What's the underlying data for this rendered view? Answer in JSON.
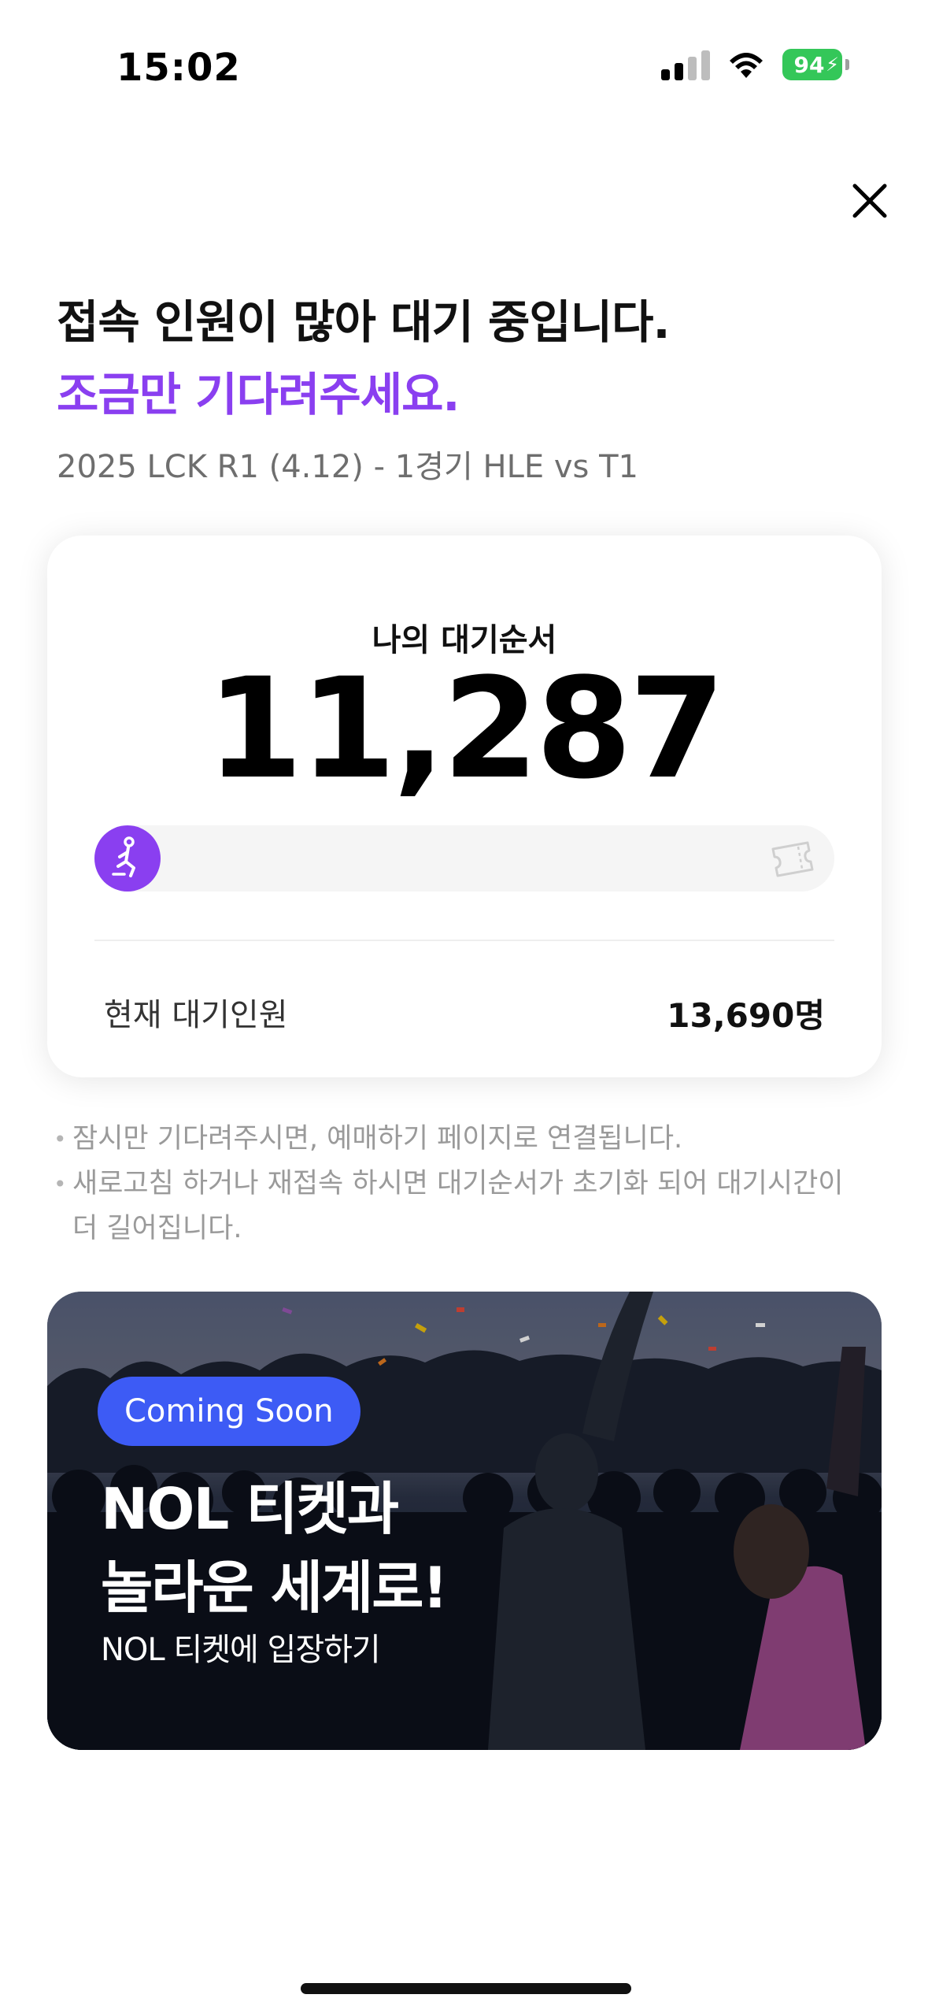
{
  "status_bar": {
    "time": "15:02",
    "battery_level": "94",
    "battery_color": "#34c759",
    "signal_icon": "cellular-signal-icon",
    "wifi_icon": "wifi-icon"
  },
  "header": {
    "close_icon": "close-icon"
  },
  "waiting": {
    "title_line1": "접속 인원이 많아 대기 중입니다.",
    "title_line2": "조금만 기다려주세요.",
    "event_name": "2025 LCK R1 (4.12) - 1경기 HLE vs T1",
    "accent_color": "#8a3ff0"
  },
  "queue_card": {
    "my_position_label": "나의 대기순서",
    "my_position": "11,287",
    "progress_fraction": 0.0,
    "runner_icon": "runner-icon",
    "ticket_icon": "ticket-icon",
    "current_waiting_label": "현재 대기인원",
    "current_waiting_value": "13,690명"
  },
  "notices": [
    "잠시만 기다려주시면, 예매하기 페이지로 연결됩니다.",
    "새로고침 하거나 재접속 하시면 대기순서가 초기화 되어 대기시간이 더 길어집니다."
  ],
  "banner": {
    "badge": "Coming Soon",
    "badge_color": "#3d5bf5",
    "headline_line1": "NOL 티켓과",
    "headline_line2": "놀라운 세계로!",
    "subtitle": "NOL 티켓에 입장하기"
  }
}
